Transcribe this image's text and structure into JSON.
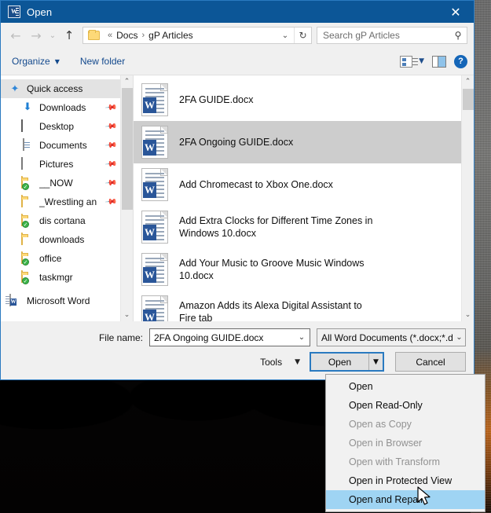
{
  "window": {
    "title": "Open",
    "title_icon": "word-document-icon",
    "close_label": "✕",
    "accent_color": "#0c5697",
    "highlight_color": "#9fd4f3"
  },
  "navbar": {
    "back_icon": "←",
    "forward_icon": "→",
    "history_icon": "⌄",
    "up_icon": "↑",
    "folder_icon": "folder-icon",
    "breadcrumb_prefix": "«",
    "breadcrumbs": [
      "Docs",
      "gP Articles"
    ],
    "separator": "›",
    "dropdown_icon": "⌄",
    "refresh_icon": "↻",
    "search": {
      "placeholder": "Search gP Articles",
      "icon": "🔍"
    }
  },
  "toolbar": {
    "organize_label": "Organize",
    "organize_caret": "▼",
    "new_folder_label": "New folder",
    "view_icon": "view-options-icon",
    "view_caret": "▼",
    "preview_pane_icon": "preview-pane-icon",
    "help_label": "?"
  },
  "sidebar": {
    "items": [
      {
        "label": "Quick access",
        "icon": "star-pin-icon",
        "selected": true,
        "pinned": false,
        "root": true
      },
      {
        "label": "Downloads",
        "icon": "download-arrow-icon",
        "selected": false,
        "pinned": true
      },
      {
        "label": "Desktop",
        "icon": "desktop-monitor-icon",
        "selected": false,
        "pinned": true
      },
      {
        "label": "Documents",
        "icon": "documents-icon",
        "selected": false,
        "pinned": true
      },
      {
        "label": "Pictures",
        "icon": "pictures-icon",
        "selected": false,
        "pinned": true
      },
      {
        "label": "__NOW",
        "icon": "folder-synced-icon",
        "selected": false,
        "pinned": true
      },
      {
        "label": "_Wrestling an",
        "icon": "folder-icon",
        "selected": false,
        "pinned": true
      },
      {
        "label": "dis cortana",
        "icon": "folder-synced-icon",
        "selected": false,
        "pinned": false
      },
      {
        "label": "downloads",
        "icon": "folder-icon",
        "selected": false,
        "pinned": false
      },
      {
        "label": "office",
        "icon": "folder-synced-icon",
        "selected": false,
        "pinned": false
      },
      {
        "label": "taskmgr",
        "icon": "folder-synced-icon",
        "selected": false,
        "pinned": false
      },
      {
        "label": "Microsoft Word",
        "icon": "word-app-icon",
        "selected": false,
        "pinned": false,
        "root": true
      }
    ],
    "scroll_up_icon": "⌃",
    "scroll_down_icon": "⌄"
  },
  "filelist": {
    "files": [
      {
        "name": "2FA GUIDE.docx",
        "icon": "word-document-icon",
        "selected": false
      },
      {
        "name": "2FA Ongoing GUIDE.docx",
        "icon": "word-document-icon",
        "selected": true
      },
      {
        "name": "Add Chromecast to Xbox One.docx",
        "icon": "word-document-icon",
        "selected": false
      },
      {
        "name": "Add Extra Clocks for Different Time Zones in Windows 10.docx",
        "icon": "word-document-icon",
        "selected": false
      },
      {
        "name": "Add Your Music to Groove Music Windows 10.docx",
        "icon": "word-document-icon",
        "selected": false
      },
      {
        "name": "Amazon Adds its Alexa Digital Assistant to Fire tab",
        "icon": "word-document-icon",
        "selected": false
      }
    ],
    "scroll_up_icon": "⌃",
    "scroll_down_icon": "⌄"
  },
  "footer": {
    "filename_label": "File name:",
    "filename_value": "2FA Ongoing GUIDE.docx",
    "filename_caret": "⌄",
    "filetype_value": "All Word Documents (*.docx;*.d",
    "filetype_caret": "⌄",
    "tools_label": "Tools",
    "tools_caret": "▼",
    "open_label": "Open",
    "open_split_caret": "▼",
    "cancel_label": "Cancel"
  },
  "open_menu": {
    "items": [
      {
        "label": "Open",
        "disabled": false,
        "highlighted": false
      },
      {
        "label": "Open Read-Only",
        "disabled": false,
        "highlighted": false
      },
      {
        "label": "Open as Copy",
        "disabled": true,
        "highlighted": false
      },
      {
        "label": "Open in Browser",
        "disabled": true,
        "highlighted": false
      },
      {
        "label": "Open with Transform",
        "disabled": true,
        "highlighted": false
      },
      {
        "label": "Open in Protected View",
        "disabled": false,
        "highlighted": false
      },
      {
        "label": "Open and Repair",
        "disabled": false,
        "highlighted": true
      }
    ]
  }
}
